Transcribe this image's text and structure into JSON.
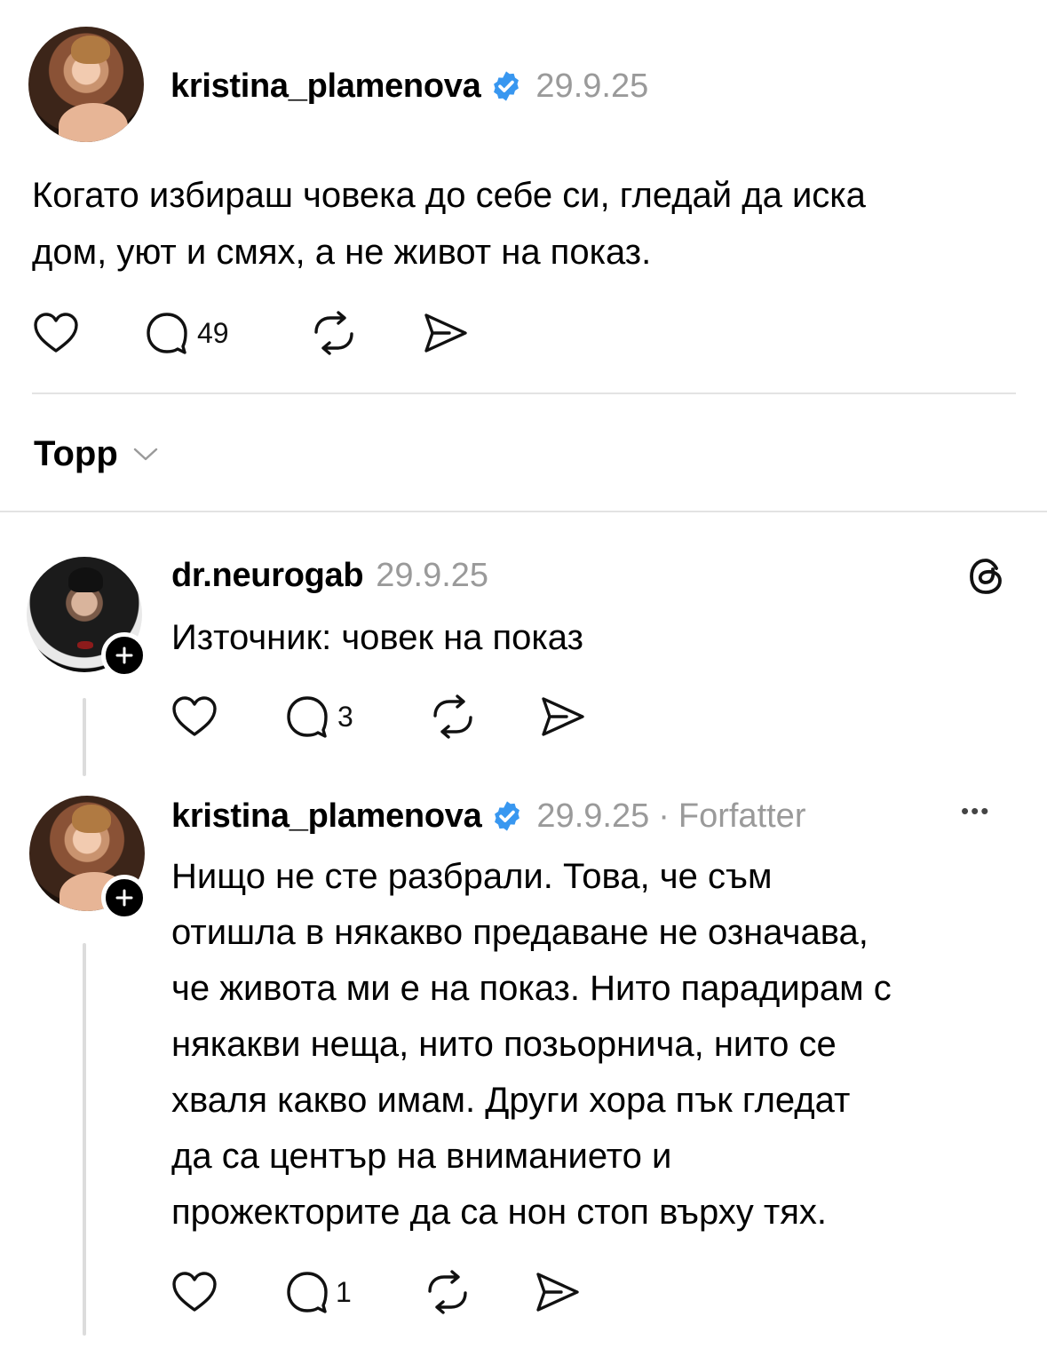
{
  "post": {
    "username": "kristina_plamenova",
    "date": "29.9.25",
    "text_lines": [
      "Когато избираш човека до себе си, гледай да иска",
      "дом, уют и смях, а не живот на показ."
    ],
    "actions": {
      "comments_count": "49"
    }
  },
  "sort": {
    "label": "Topp"
  },
  "replies": [
    {
      "username": "dr.neurogab",
      "date": "29.9.25",
      "text_lines": [
        "Източник: човек на показ"
      ],
      "actions": {
        "comments_count": "3"
      }
    },
    {
      "username": "kristina_plamenova",
      "date": "29.9.25",
      "separator": "·",
      "author_tag": "Forfatter",
      "more": "•••",
      "text_lines": [
        "Нищо не сте разбрали. Това, че съм",
        "отишла в някакво предаване не означава,",
        "че живота ми е на показ. Нито парадирам с",
        "някакви неща, нито позьорнича, нито се",
        "хваля какво имам. Други хора пък гледат",
        "да са център на вниманието и",
        "прожекторите да са нон стоп върху тях."
      ],
      "actions": {
        "comments_count": "1"
      }
    }
  ],
  "icons": {
    "verified": "verified-badge-icon",
    "like": "heart-icon",
    "comment": "comment-bubble-icon",
    "repost": "repost-icon",
    "share": "send-icon",
    "threads": "threads-logo-icon",
    "follow": "plus-icon",
    "sort_toggle": "chevron-down-icon"
  },
  "colors": {
    "verified": "#3897f0",
    "meta": "#9a9a9a",
    "separator": "#e3e3e3"
  }
}
